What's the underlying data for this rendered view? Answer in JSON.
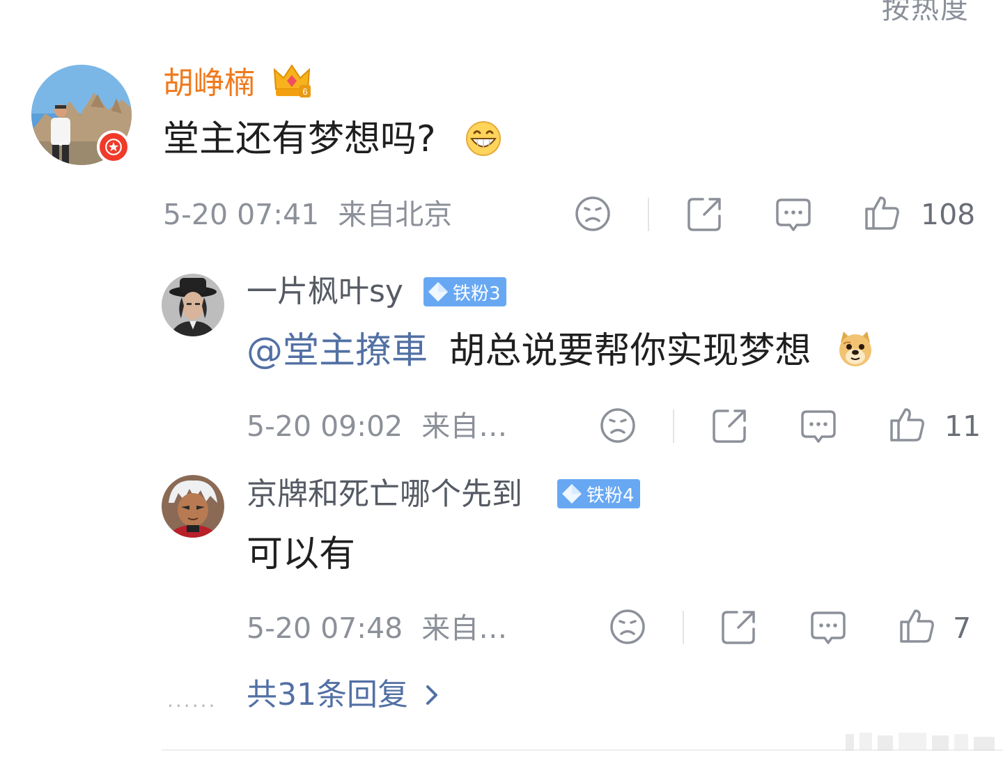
{
  "header": {
    "sort_label": "按热度"
  },
  "main_comment": {
    "username": "胡峥楠",
    "text": "堂主还有梦想吗?",
    "time": "5-20 07:41",
    "location": "来自北京",
    "like_count": "108",
    "icons": [
      "dislike-icon",
      "share-icon",
      "comment-icon",
      "like-icon"
    ],
    "emoji": "grin-emoji",
    "badge": "crown-vip-icon",
    "verified": "verified-star-icon"
  },
  "replies": [
    {
      "username": "一片枫叶sy",
      "fan_badge": "铁粉3",
      "mention": "@堂主撩車",
      "text": "胡总说要帮你实现梦想",
      "emoji": "doge-emoji",
      "time": "5-20 09:02",
      "location": "来自…",
      "like_count": "11"
    },
    {
      "username": "京牌和死亡哪个先到",
      "fan_badge": "铁粉4",
      "mention": "",
      "text": "可以有",
      "time": "5-20 07:48",
      "location": "来自…",
      "like_count": "7"
    }
  ],
  "footer": {
    "dots": "······",
    "replies_link": "共31条回复"
  },
  "colors": {
    "username_orange": "#f07a1e",
    "link_blue": "#5270a4",
    "fan_badge_blue": "#68a8f3",
    "meta_gray": "#8c9099",
    "verified_red": "#f03a2a"
  }
}
